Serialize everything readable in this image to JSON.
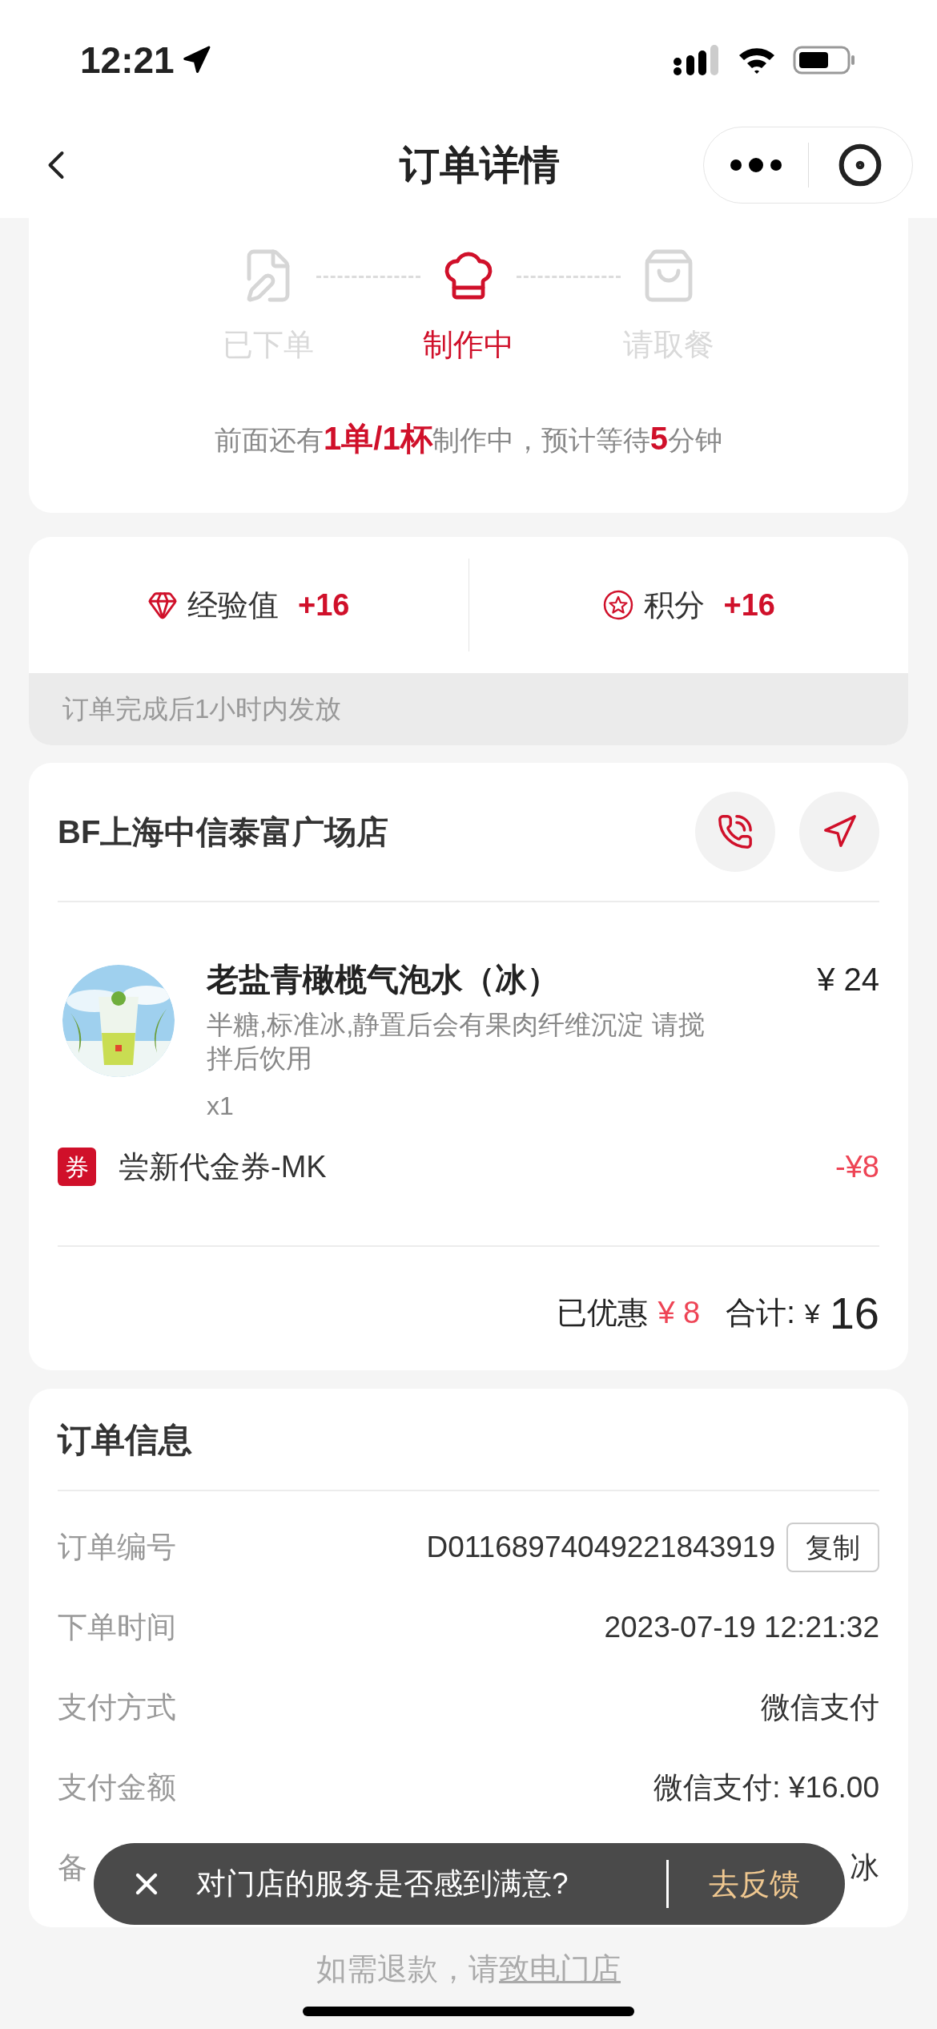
{
  "status_bar": {
    "time": "12:21"
  },
  "nav": {
    "title": "订单详情"
  },
  "progress": {
    "steps": [
      {
        "label": "已下单",
        "kind": "placed",
        "selected": false
      },
      {
        "label": "制作中",
        "kind": "making",
        "selected": true
      },
      {
        "label": "请取餐",
        "kind": "pickup",
        "selected": false
      }
    ],
    "message": "前面还有**1单/1杯**制作中，预计等待**5**分钟"
  },
  "rewards": {
    "items": [
      {
        "kind": "exp",
        "label": "经验值",
        "value": "+16"
      },
      {
        "kind": "points",
        "label": "积分",
        "value": "+16"
      }
    ],
    "note": "订单完成后1小时内发放"
  },
  "store": {
    "name": "BF上海中信泰富广场店",
    "product": {
      "name": "老盐青橄榄气泡水（冰）",
      "price": "¥ 24",
      "description": "半糖,标准冰,静置后会有果肉纤维沉淀 请搅拌后饮用",
      "quantity": "x1"
    },
    "coupon": {
      "badge": "券",
      "name": "尝新代金券-MK",
      "amount": "-¥8"
    },
    "summary": {
      "discount_label": "已优惠",
      "discount": "¥ 8",
      "total_label": "合计:",
      "currency": "¥",
      "total": "16"
    }
  },
  "order_info": {
    "title": "订单信息",
    "rows": [
      {
        "label": "订单编号",
        "value": "D01168974049221843919",
        "action": "复制"
      },
      {
        "label": "下单时间",
        "value": "2023-07-19 12:21:32"
      },
      {
        "label": "支付方式",
        "value": "微信支付"
      },
      {
        "label": "支付金额",
        "value": "微信支付: ¥16.00"
      },
      {
        "label": "备",
        "value": "冰"
      }
    ]
  },
  "toast": {
    "message": "对门店的服务是否感到满意?",
    "action": "去反馈"
  },
  "footer": {
    "text": "如需退款，请",
    "link": "致电门店"
  }
}
